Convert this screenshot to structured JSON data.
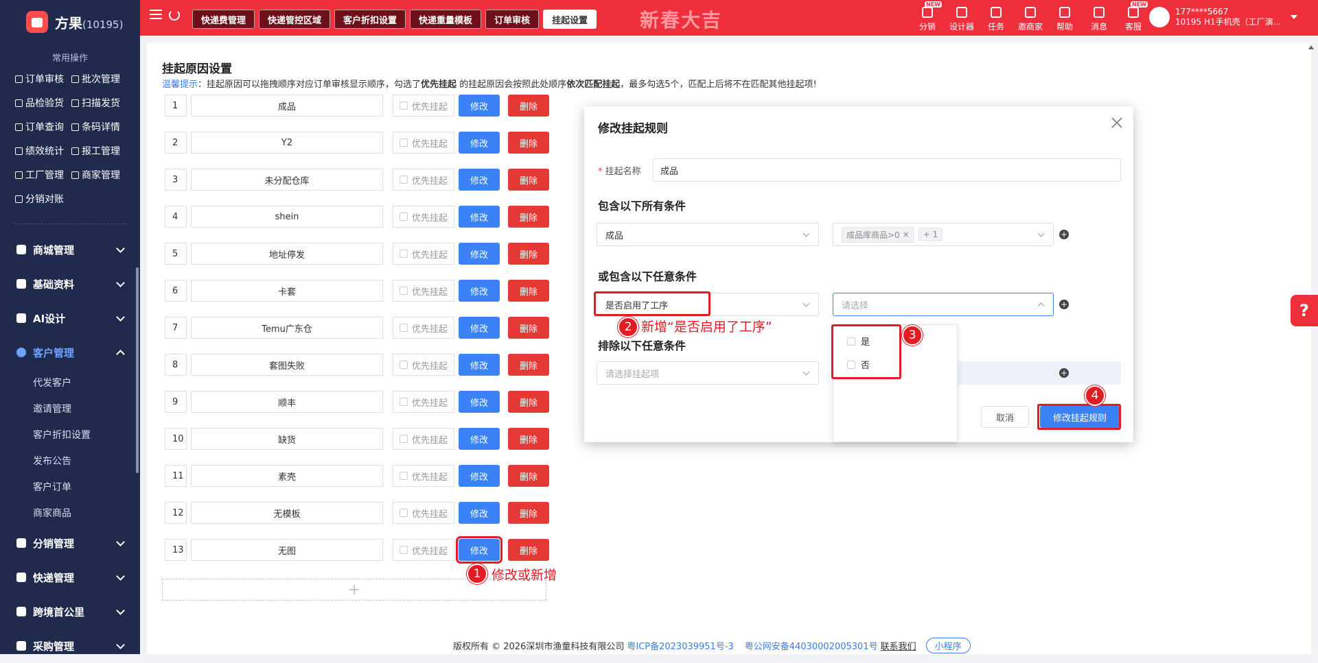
{
  "brand": {
    "name": "方果",
    "count": "(10195)"
  },
  "sidebar": {
    "common_title": "常用操作",
    "quick": [
      "订单审核",
      "批次管理",
      "品检验货",
      "扫描发货",
      "订单查询",
      "条码详情",
      "绩效统计",
      "报工管理",
      "工厂管理",
      "商家管理",
      "分销对账"
    ],
    "menus": [
      {
        "label": "商城管理",
        "icon": "store-icon"
      },
      {
        "label": "基础资料",
        "icon": "database-icon"
      },
      {
        "label": "AI设计",
        "icon": "ai-icon"
      },
      {
        "label": "客户管理",
        "icon": "user-icon",
        "active": true
      }
    ],
    "sub_items": [
      "代发客户",
      "邀请管理",
      "客户折扣设置",
      "发布公告",
      "客户订单",
      "商家商品"
    ],
    "menus2": [
      {
        "label": "分销管理",
        "icon": "share-icon"
      },
      {
        "label": "快递管理",
        "icon": "truck-icon"
      },
      {
        "label": "跨境首公里",
        "icon": "globe-icon"
      },
      {
        "label": "采购管理",
        "icon": "cart-icon"
      }
    ]
  },
  "topbar": {
    "tabs": [
      "快递费管理",
      "快递管控区域",
      "客户折扣设置",
      "快递重量模板",
      "订单审核",
      "挂起设置"
    ],
    "active_tab": 5,
    "banner": "新春大吉",
    "icons": [
      {
        "label": "分销",
        "icon": "coin-icon",
        "new": true
      },
      {
        "label": "设计器",
        "icon": "image-icon"
      },
      {
        "label": "任务",
        "icon": "task-icon"
      },
      {
        "label": "邀商家",
        "icon": "people-icon"
      },
      {
        "label": "帮助",
        "icon": "help-icon"
      },
      {
        "label": "消息",
        "icon": "message-icon"
      },
      {
        "label": "客服",
        "icon": "support-icon",
        "new": true
      }
    ],
    "new_badge": "NEW",
    "user_phone": "177****5667",
    "user_desc": "10195  H1手机壳（工厂演..."
  },
  "page": {
    "title": "挂起原因设置",
    "tip_label": "温馨提示",
    "tip_part1": "：挂起原因可以拖拽顺序对应订单审核显示顺序，勾选了",
    "tip_bold1": "优先挂起",
    "tip_part2": "的挂起原因会按照此处顺序",
    "tip_bold2": "依次匹配挂起",
    "tip_part3": "，最多勾选5个，匹配上后将不在匹配其他挂起项!",
    "priority_label": "优先挂起",
    "edit_label": "修改",
    "delete_label": "删除",
    "add_symbol": "+",
    "rows": [
      {
        "n": "1",
        "name": "成品"
      },
      {
        "n": "2",
        "name": "Y2"
      },
      {
        "n": "3",
        "name": "未分配仓库"
      },
      {
        "n": "4",
        "name": "shein"
      },
      {
        "n": "5",
        "name": "地址停发"
      },
      {
        "n": "6",
        "name": "卡套"
      },
      {
        "n": "7",
        "name": "Temu广东仓"
      },
      {
        "n": "8",
        "name": "套图失败"
      },
      {
        "n": "9",
        "name": "顺丰"
      },
      {
        "n": "10",
        "name": "缺货"
      },
      {
        "n": "11",
        "name": "素壳"
      },
      {
        "n": "12",
        "name": "无模板"
      },
      {
        "n": "13",
        "name": "无图"
      }
    ]
  },
  "modal": {
    "title": "修改挂起规则",
    "name_label": "挂起名称",
    "name_value": "成品",
    "section_all": "包含以下所有条件",
    "all_select": "成品",
    "all_tag": "成品库商品>0",
    "all_more": "+ 1",
    "section_any": "或包含以下任意条件",
    "any_select": "是否启用了工序",
    "any_placeholder": "请选择",
    "section_exclude": "排除以下任意条件",
    "exclude_placeholder": "请选择挂起项",
    "options": [
      "是",
      "否"
    ],
    "cancel": "取消",
    "submit": "修改挂起规则"
  },
  "annotations": {
    "a1": {
      "num": "1",
      "text": "修改或新增"
    },
    "a2": {
      "num": "2",
      "text": "新增“是否启用了工序”"
    },
    "a3": {
      "num": "3"
    },
    "a4": {
      "num": "4"
    }
  },
  "footer": {
    "copyright": "版权所有 © 2026深圳市渔童科技有限公司",
    "icp": "粤ICP备2023039951号-3",
    "police": "粤公网安备44030002005301号",
    "contact": "联系我们",
    "mini": "小程序"
  },
  "help_float": "?",
  "colors": {
    "brand_red": "#ee2f3c",
    "sidebar": "#1f2a4d",
    "primary": "#3b82f6",
    "danger": "#e53935",
    "annotation": "#e31b23"
  }
}
